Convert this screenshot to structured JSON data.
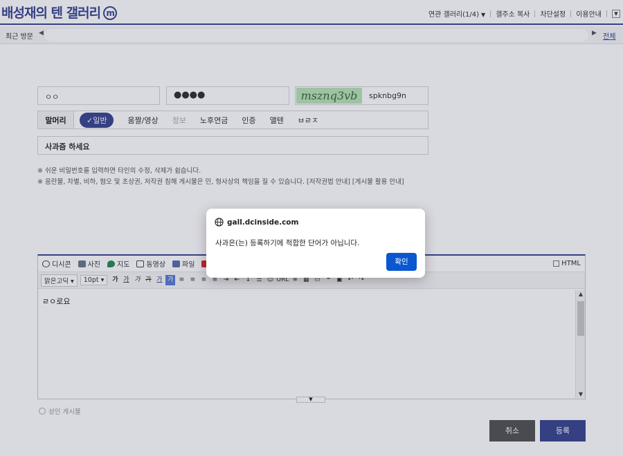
{
  "header": {
    "gallery_title": "배성재의 텐 갤러리",
    "minor_badge": "m",
    "menu": {
      "related": "연관 갤러리(1/4)",
      "bookmark": "갤주소 복사",
      "block": "차단설정",
      "guide": "이용안내"
    }
  },
  "recent": {
    "label": "최근 방문",
    "all_label": "전체"
  },
  "form": {
    "nickname": "ㅇㅇ",
    "password_mask": "●●●●",
    "captcha_image_text": "msznq3vb",
    "captcha_input": "spknbg9n",
    "head_lead": "말머리",
    "heads": [
      "일반",
      "움짤/영상",
      "정보",
      "노후연금",
      "인증",
      "앨텐",
      "ㅂㄹㅈ"
    ],
    "selected_head": "일반",
    "subject": "사과즘 하세요",
    "notice_1": "※ 쉬운 비밀번호를 입력하면 타인의 수정, 삭제가 쉽습니다.",
    "notice_2": "※ 음란물, 차별, 비하, 혐오 및 초상권, 저작권 침해 게시물은 민, 형사상의 책임을 질 수 있습니다. [저작권법 안내] [게시물 활용 안내]"
  },
  "editor": {
    "tabs": [
      "디시콘",
      "사진",
      "지도",
      "동영상",
      "파일",
      "유튜"
    ],
    "html_label": "HTML",
    "font_select": "맑은고딕",
    "size_select": "10pt",
    "url_label": "URL",
    "content": "ㄹㅇ로요"
  },
  "footer": {
    "adult_label": "성인 게시물",
    "cancel": "취소",
    "submit": "등록"
  },
  "dialog": {
    "origin": "gall.dcinside.com",
    "message": "사과은(는) 등록하기에 적합한 단어가 아닙니다.",
    "ok": "확인",
    "ok_color": "#0b57d0"
  },
  "colors": {
    "brand": "#3b4890"
  }
}
